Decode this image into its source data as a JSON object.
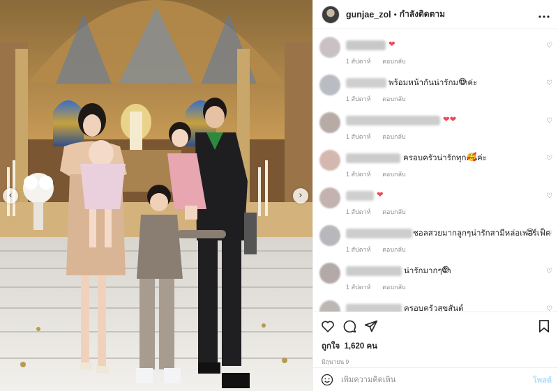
{
  "post": {
    "username": "gunjae_zol",
    "separator": "•",
    "follow_status": "กำลังติดตาม",
    "more_icon": "more-horizontal-icon"
  },
  "colors": {
    "meta_gray": "#8e8e8e",
    "heart_red": "#ed4956",
    "post_button_disabled": "#b2dffc",
    "border": "#efefef"
  },
  "comments": [
    {
      "text": "",
      "emoji": "❤",
      "time": "1 สัปดาห์",
      "reply": "ตอบกลับ"
    },
    {
      "text": "พร้อมหน้ากันน่ารักมากค่ะ",
      "emoji": "😍",
      "time": "1 สัปดาห์",
      "reply": "ตอบกลับ"
    },
    {
      "text": "",
      "emoji": "❤❤",
      "time": "1 สัปดาห์",
      "reply": "ตอบกลับ"
    },
    {
      "text": "ครอบครัวน่ารักทุกคนค่ะ",
      "emoji": "🥰",
      "time": "1 สัปดาห์",
      "reply": "ตอบกลับ"
    },
    {
      "text": "",
      "emoji": "❤",
      "time": "1 สัปดาห์",
      "reply": "ตอบกลับ"
    },
    {
      "text": "ชอลสวยมากลูกๆน่ารักสามีหล่อเพอร์เฟ็ค",
      "emoji": "😍",
      "time": "1 สัปดาห์",
      "reply": "ตอบกลับ"
    },
    {
      "text": "น่ารักมากๆจ้า",
      "emoji": "😍",
      "time": "1 สัปดาห์",
      "reply": "ตอบกลับ"
    },
    {
      "text": "ครอบครัวสุขสันต์",
      "emoji": "",
      "time": "",
      "reply": ""
    }
  ],
  "actions": {
    "like_icon": "heart-outline-icon",
    "comment_icon": "comment-bubble-icon",
    "share_icon": "paper-plane-icon",
    "save_icon": "bookmark-icon"
  },
  "likes": {
    "label": "ถูกใจ",
    "count": "1,620",
    "unit": "คน"
  },
  "post_date": "มิถุนายน 9",
  "add_comment": {
    "placeholder": "เพิ่มความคิดเห็น",
    "post_label": "โพสต์",
    "emoji_icon": "smiley-icon"
  },
  "carousel": {
    "prev_icon": "chevron-left-icon",
    "next_icon": "chevron-right-icon",
    "prev_glyph": "‹",
    "next_glyph": "›"
  }
}
